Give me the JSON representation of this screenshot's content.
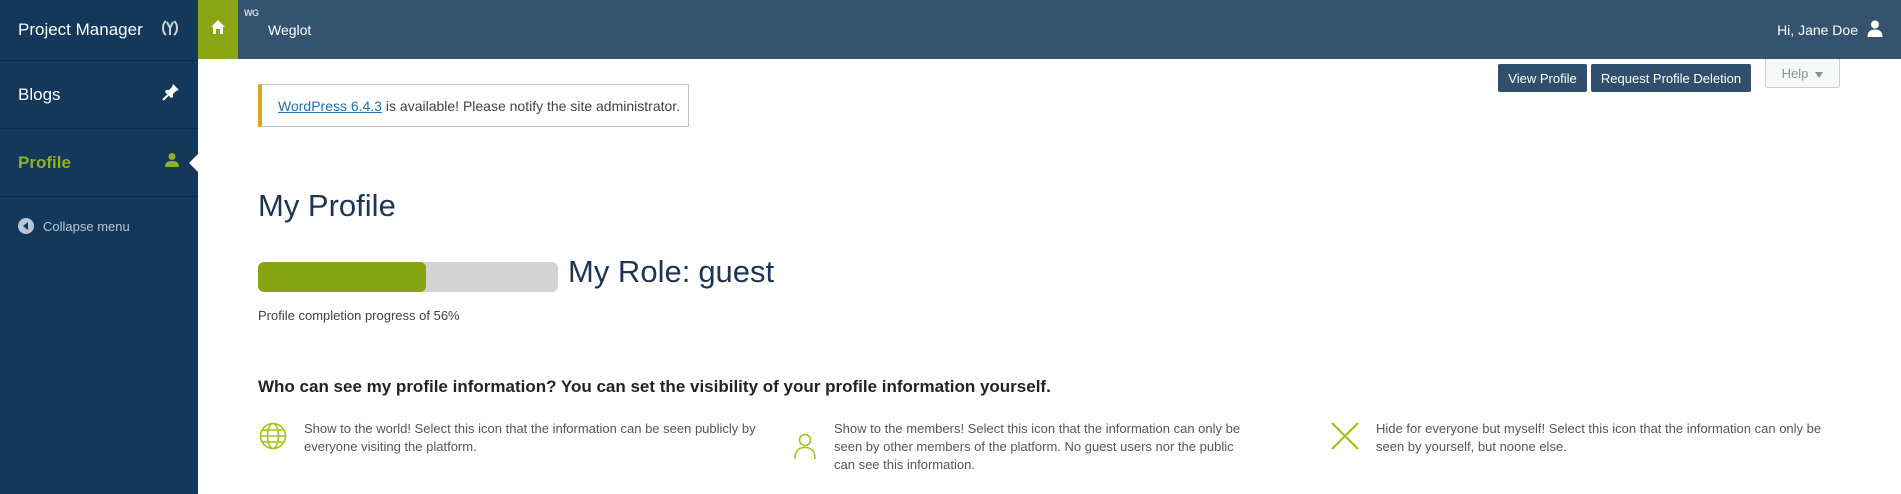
{
  "sidebar": {
    "brand": "Project Manager",
    "items": [
      {
        "label": "Blogs",
        "icon": "pin-icon"
      },
      {
        "label": "Profile",
        "icon": "user-icon",
        "active": true
      }
    ],
    "collapse_label": "Collapse menu"
  },
  "topbar": {
    "home_icon": "home-icon",
    "badge": "WG",
    "plugin_label": "Weglot",
    "greeting": "Hi, Jane Doe"
  },
  "header_buttons": {
    "view_profile": "View Profile",
    "request_deletion": "Request Profile Deletion",
    "help": "Help"
  },
  "notice": {
    "link_text": "WordPress 6.4.3",
    "message": " is available! Please notify the site administrator."
  },
  "profile": {
    "title": "My Profile",
    "progress_percent": 56,
    "role_label": "My Role:",
    "role_value": "guest",
    "progress_text": "Profile completion progress of 56%"
  },
  "visibility": {
    "heading": "Who can see my profile information? You can set the visibility of your profile information yourself.",
    "options": [
      {
        "icon": "globe-icon",
        "text": "Show to the world! Select this icon that the information can be seen publicly by everyone visiting the platform."
      },
      {
        "icon": "member-icon",
        "text": "Show to the members! Select this icon that the information can only be seen by other members of the platform. No guest users nor the public can see this information."
      },
      {
        "icon": "cross-icon",
        "text": "Hide for everyone but myself! Select this icon that the information can only be seen by yourself, but noone else."
      }
    ]
  },
  "colors": {
    "sidebar_bg": "#14385a",
    "topbar_bg": "#33536f",
    "accent_green": "#86a511",
    "notice_border": "#dba617"
  }
}
